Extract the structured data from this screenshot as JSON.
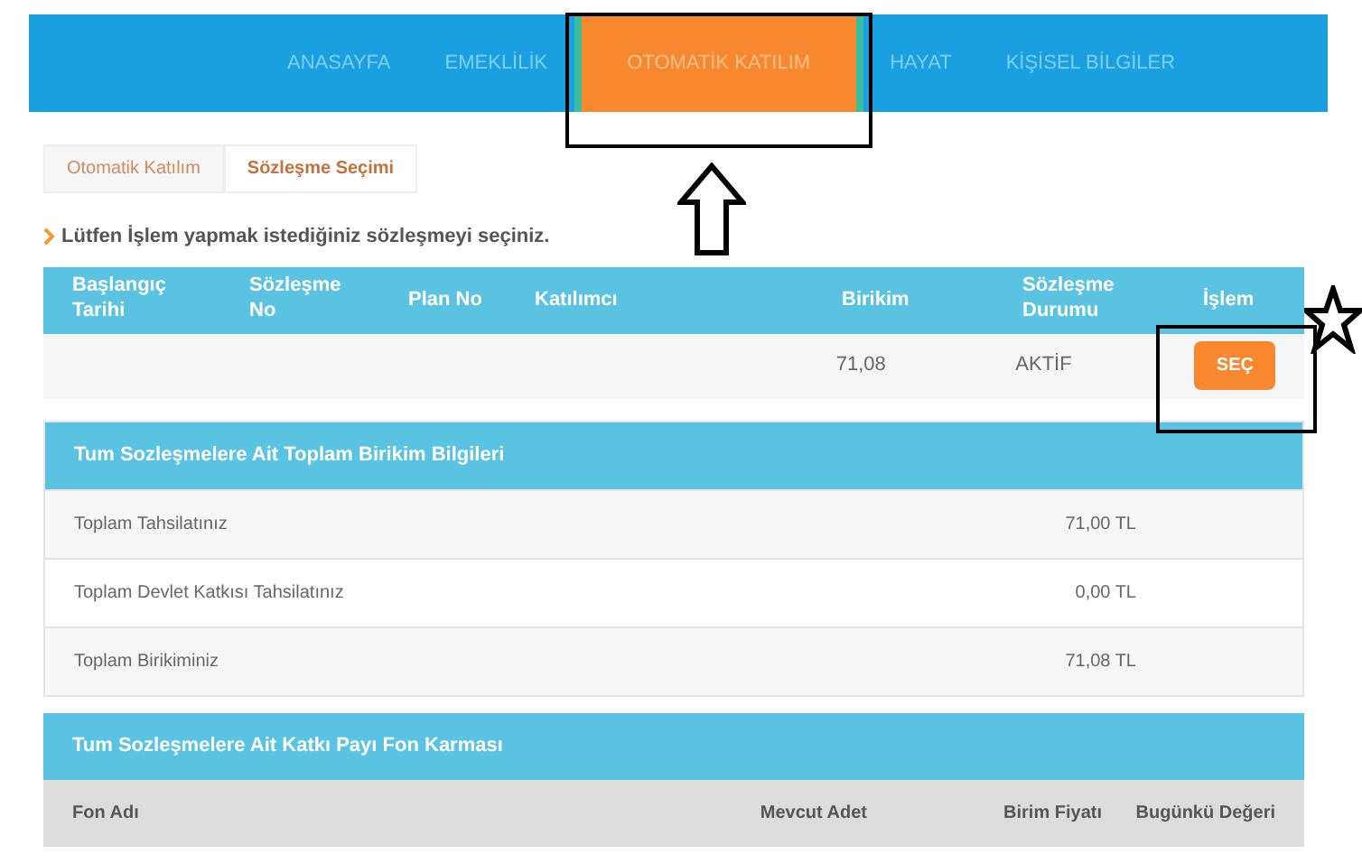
{
  "nav": [
    {
      "label": "ANASAYFA",
      "selected": false
    },
    {
      "label": "EMEKLİLİK",
      "selected": false
    },
    {
      "label": "OTOMATİK KATILIM",
      "selected": true
    },
    {
      "label": "HAYAT",
      "selected": false
    },
    {
      "label": "KİŞİSEL BİLGİLER",
      "selected": false
    }
  ],
  "breadcrumb": [
    {
      "label": "Otomatik Katılım",
      "selected": false
    },
    {
      "label": "Sözleşme Seçimi",
      "selected": true
    }
  ],
  "instruction": "Lütfen İşlem yapmak istediğiniz sözleşmeyi seçiniz.",
  "contracts": {
    "columns": [
      "Başlangıç Tarihi",
      "Sözleşme No",
      "Plan No",
      "Katılımcı",
      "Birikim",
      "Sözleşme Durumu",
      "İşlem"
    ],
    "rows": [
      {
        "birikim": "71,08",
        "status": "AKTİF",
        "action": "SEÇ"
      }
    ]
  },
  "totals": {
    "title": "Tum Sozleşmelere Ait Toplam Birikim Bilgileri",
    "rows": [
      {
        "label": "Toplam Tahsilatınız",
        "value": "71,00 TL"
      },
      {
        "label": "Toplam Devlet Katkısı Tahsilatınız",
        "value": "0,00 TL"
      },
      {
        "label": "Toplam Birikiminiz",
        "value": "71,08 TL"
      }
    ]
  },
  "funds": {
    "title": "Tum Sozleşmelere Ait Katkı Payı Fon Karması",
    "columns": [
      "Fon Adı",
      "Mevcut Adet",
      "Birim Fiyatı",
      "Bugünkü Değeri"
    ]
  }
}
